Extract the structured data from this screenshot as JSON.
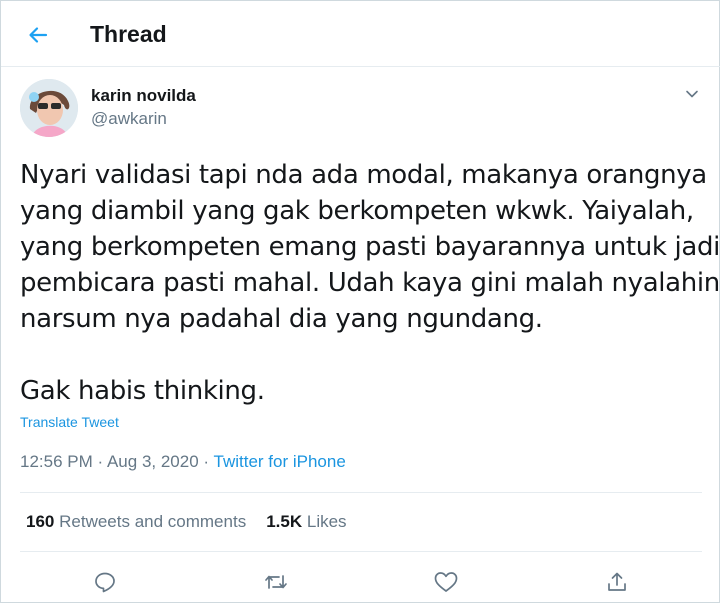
{
  "header": {
    "title": "Thread",
    "back_icon": "back-arrow-icon"
  },
  "author": {
    "display_name": "karin novilda",
    "handle": "@awkarin"
  },
  "tweet": {
    "lines": [
      "Nyari validasi tapi nda ada modal, makanya orangnya",
      "yang diambil yang gak berkompeten wkwk. Yaiyalah,",
      "yang berkompeten emang pasti bayarannya untuk jadi",
      "pembicara pasti mahal. Udah kaya gini malah nyalahin",
      "narsum nya padahal dia yang ngundang."
    ],
    "closing": "Gak habis thinking.",
    "translate_label": "Translate Tweet",
    "time": "12:56 PM",
    "separator": "·",
    "date": "Aug 3, 2020",
    "source": "Twitter for iPhone"
  },
  "stats": {
    "retweets_count": "160",
    "retweets_label": "Retweets and comments",
    "likes_count": "1.5K",
    "likes_label": "Likes"
  },
  "actions": [
    "reply-icon",
    "retweet-icon",
    "like-icon",
    "share-icon"
  ],
  "colors": {
    "accent": "#1b95e0",
    "secondary_text": "#657786",
    "primary_text": "#14171a",
    "divider": "#e6ecf0"
  }
}
